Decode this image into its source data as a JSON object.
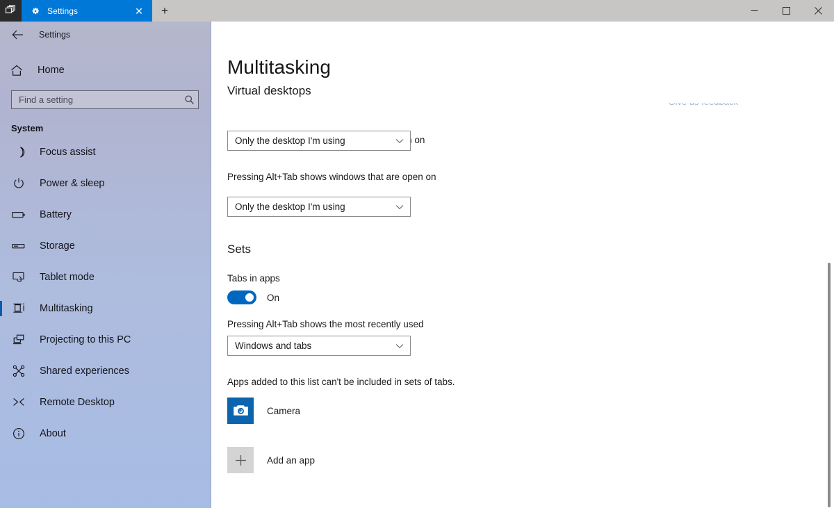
{
  "titlebar": {
    "sets_button_icon": "tab-list-icon",
    "tab": {
      "icon": "gear-icon",
      "title": "Settings",
      "close_label": "✕"
    },
    "new_tab_label": "+",
    "minimize_label": "─",
    "maximize_label": "□",
    "close_label": "✕"
  },
  "sidebar": {
    "nav_header_title": "Settings",
    "back_icon": "back-arrow-icon",
    "home": {
      "label": "Home",
      "icon": "home-icon"
    },
    "search": {
      "placeholder": "Find a setting",
      "value": "",
      "icon": "search-icon"
    },
    "section_title": "System",
    "items": [
      {
        "label": "Focus assist",
        "icon": "moon-icon",
        "selected": false
      },
      {
        "label": "Power & sleep",
        "icon": "power-icon",
        "selected": false
      },
      {
        "label": "Battery",
        "icon": "battery-icon",
        "selected": false
      },
      {
        "label": "Storage",
        "icon": "storage-icon",
        "selected": false
      },
      {
        "label": "Tablet mode",
        "icon": "tablet-icon",
        "selected": false
      },
      {
        "label": "Multitasking",
        "icon": "multitasking-icon",
        "selected": true
      },
      {
        "label": "Projecting to this PC",
        "icon": "projecting-icon",
        "selected": false
      },
      {
        "label": "Shared experiences",
        "icon": "shared-experiences-icon",
        "selected": false
      },
      {
        "label": "Remote Desktop",
        "icon": "remote-desktop-icon",
        "selected": false
      },
      {
        "label": "About",
        "icon": "info-icon",
        "selected": false
      }
    ]
  },
  "main": {
    "page_title": "Multitasking",
    "feedback_link": "Give us feedback",
    "virtual_desktops": {
      "group_title": "Virtual desktops",
      "taskbar_label": "On the taskbar, show windows that are open on",
      "taskbar_value": "Only the desktop I'm using",
      "alttab_label": "Pressing Alt+Tab shows windows that are open on",
      "alttab_value": "Only the desktop I'm using"
    },
    "sets": {
      "group_title": "Sets",
      "tabs_in_apps_label": "Tabs in apps",
      "tabs_in_apps_state": "On",
      "alttab_recent_label": "Pressing Alt+Tab shows the most recently used",
      "alttab_recent_value": "Windows and tabs",
      "excluded_note": "Apps added to this list can't be included in sets of tabs.",
      "apps": [
        {
          "name": "Camera",
          "icon": "camera-icon"
        }
      ],
      "add_app_label": "Add an app",
      "add_app_icon": "plus-icon"
    }
  },
  "colors": {
    "accent": "#0078d7",
    "toggle_on": "#0067c0",
    "selection_bar": "#0a5ca8",
    "camera_tile": "#0b64ad"
  }
}
